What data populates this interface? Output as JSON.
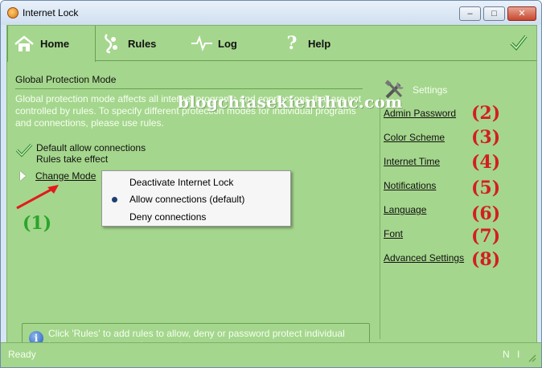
{
  "window": {
    "title": "Internet Lock",
    "buttons": {
      "minimize": "–",
      "maximize": "□",
      "close": "✕"
    }
  },
  "tabs": [
    {
      "label": "Home",
      "icon": "home-icon",
      "active": true
    },
    {
      "label": "Rules",
      "icon": "rules-icon"
    },
    {
      "label": "Log",
      "icon": "log-icon"
    },
    {
      "label": "Help",
      "icon": "help-icon"
    }
  ],
  "home": {
    "section_title": "Global Protection Mode",
    "description": "Global protection mode affects all internet programs and connections that are not controlled by rules. To specify different protection modes for individual programs and connections, please use rules.",
    "state_line1": "Default allow connections",
    "state_line2": "Rules take effect",
    "change_mode": "Change Mode"
  },
  "popup_menu": {
    "items": [
      "Deactivate Internet Lock",
      "Allow connections (default)",
      "Deny connections"
    ],
    "selected_index": 1
  },
  "settings": {
    "heading": "Settings",
    "links": [
      "Admin Password",
      "Color Scheme",
      "Internet Time",
      "Notifications",
      "Language",
      "Font",
      "Advanced Settings"
    ]
  },
  "annotations": {
    "watermark": "blogchiasekienthuc.com",
    "numbers": [
      "(1)",
      "(2)",
      "(3)",
      "(4)",
      "(5)",
      "(6)",
      "(7)",
      "(8)"
    ],
    "colors": {
      "red": "#d21f1f",
      "green": "#2aa52a"
    }
  },
  "info": {
    "text": "Click 'Rules' to add rules to allow, deny or password protect individual internet programs and connections."
  },
  "status": {
    "text": "Ready",
    "right": "N I"
  },
  "theme": {
    "app_background": "#a5d68d",
    "border": "#6aa052"
  }
}
